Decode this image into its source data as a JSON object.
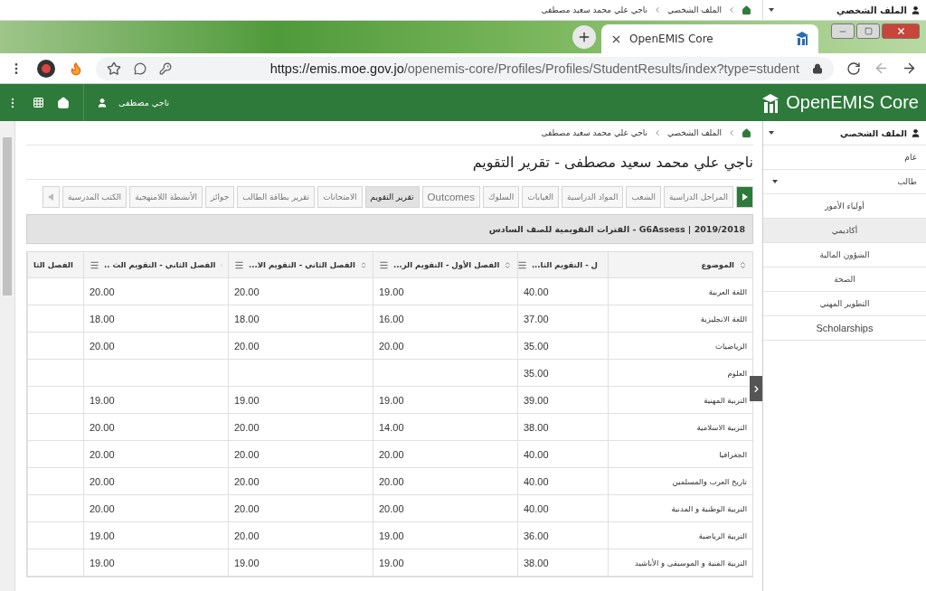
{
  "top_strip": {
    "profile_menu": "الملف الشخصي",
    "breadcrumb": [
      "الملف الشخصي",
      "ناجي علي محمد سعيد مصطفى"
    ]
  },
  "browser": {
    "tab_title": "OpenEMIS Core",
    "url_host": "https://emis.moe.gov.jo",
    "url_path": "/openemis-core/Profiles/Profiles/StudentResults/index?type=student"
  },
  "header": {
    "app_name": "OpenEMIS Core",
    "user": "ناجي مصطفى"
  },
  "breadcrumb": [
    "الملف الشخصي",
    "ناجي علي محمد سعيد مصطفى"
  ],
  "page_title": "ناجي علي محمد سعيد مصطفى - تقرير التقويم",
  "tabs": [
    {
      "label": "المراحل الدراسية",
      "selected": false
    },
    {
      "label": "الشعب",
      "selected": false
    },
    {
      "label": "المواد الدراسية",
      "selected": false
    },
    {
      "label": "الغيابات",
      "selected": false
    },
    {
      "label": "السلوك",
      "selected": false
    },
    {
      "label": "Outcomes",
      "selected": false
    },
    {
      "label": "تقرير التقويم",
      "selected": true
    },
    {
      "label": "الامتحانات",
      "selected": false
    },
    {
      "label": "تقرير بطاقة الطالب",
      "selected": false
    },
    {
      "label": "جوائز",
      "selected": false
    },
    {
      "label": "الأنشطة اللامنهجية",
      "selected": false
    },
    {
      "label": "الكتب المدرسية",
      "selected": false
    }
  ],
  "section_title": "2019/2018 | G6Assess - الفترات التقويمية للصف السادس",
  "table": {
    "columns": [
      {
        "label": "الموضوع",
        "menu": false
      },
      {
        "label": "ل - التقويم الثا...",
        "menu": true
      },
      {
        "label": "الفصل الأول - التقويم الر...",
        "menu": true
      },
      {
        "label": "الفصل الثاني - التقويم الا...",
        "menu": true
      },
      {
        "label": "الفصل الثاني - التقويم الث ..",
        "menu": true
      },
      {
        "label": "الفصل الثا",
        "menu": false
      }
    ],
    "rows": [
      {
        "subject": "اللغة العربية",
        "values": [
          "40.00",
          "19.00",
          "20.00",
          "20.00"
        ]
      },
      {
        "subject": "اللغة الانجليزية",
        "values": [
          "37.00",
          "16.00",
          "18.00",
          "18.00"
        ]
      },
      {
        "subject": "الرياضيات",
        "values": [
          "35.00",
          "20.00",
          "20.00",
          "20.00"
        ]
      },
      {
        "subject": "العلوم",
        "values": [
          "35.00"
        ]
      },
      {
        "subject": "التربية المهنية",
        "values": [
          "39.00",
          "19.00",
          "19.00",
          "19.00"
        ]
      },
      {
        "subject": "التربية الاسلامية",
        "values": [
          "38.00",
          "14.00",
          "20.00",
          "20.00"
        ]
      },
      {
        "subject": "الجغرافيا",
        "values": [
          "40.00",
          "20.00",
          "20.00",
          "20.00"
        ]
      },
      {
        "subject": "تاريخ العرب والمسلمين",
        "values": [
          "40.00",
          "20.00",
          "20.00",
          "20.00"
        ]
      },
      {
        "subject": "التربية الوطنية و المدنية",
        "values": [
          "40.00",
          "20.00",
          "20.00",
          "20.00"
        ]
      },
      {
        "subject": "التربية الرياضية",
        "values": [
          "36.00",
          "19.00",
          "20.00",
          "19.00"
        ]
      },
      {
        "subject": "التربية الفنية و الموسيقى و الأناشيد",
        "values": [
          "38.00",
          "19.00",
          "19.00",
          "19.00"
        ]
      }
    ]
  },
  "sidebar": {
    "title": "الملف الشخصي",
    "items": [
      {
        "label": "عام",
        "selected": false
      },
      {
        "label": "طالب",
        "selected": false,
        "expanded": true,
        "children": [
          {
            "label": "أولياء الأمور",
            "selected": false
          },
          {
            "label": "أكاديمي",
            "selected": true
          },
          {
            "label": "الشؤون المالية",
            "selected": false
          },
          {
            "label": "الصحة",
            "selected": false
          },
          {
            "label": "التطوير المهني",
            "selected": false
          },
          {
            "label": "Scholarships",
            "selected": false
          }
        ]
      }
    ]
  }
}
